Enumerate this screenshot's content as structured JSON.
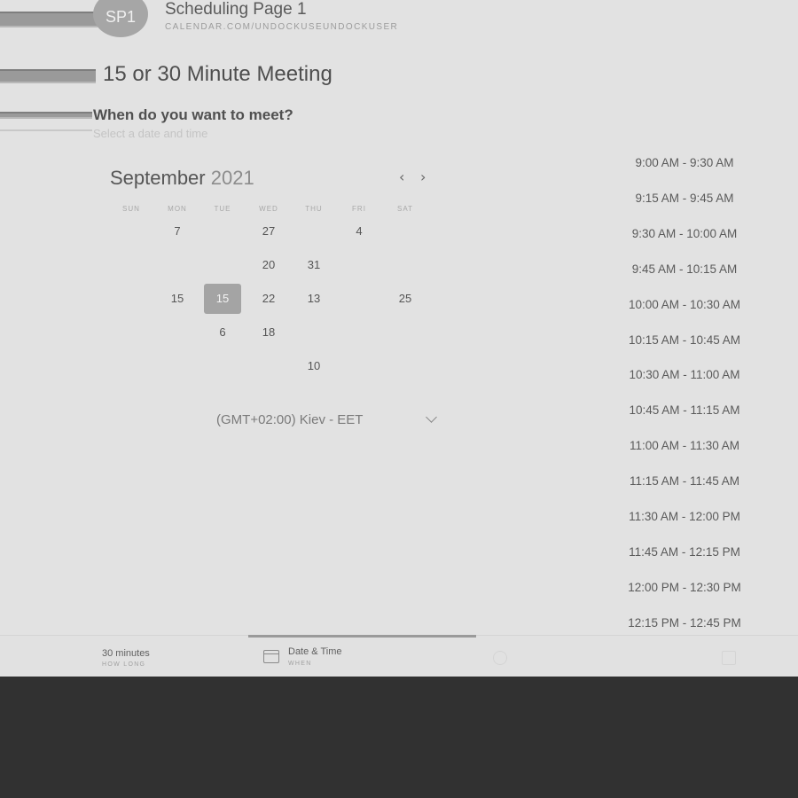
{
  "header": {
    "avatar_initials": "SP1",
    "page_name": "Scheduling Page 1",
    "page_url": "CALENDAR.COM/UNDOCKUSEUNDOCKUSER"
  },
  "event": {
    "title": "15 or 30 Minute Meeting",
    "question": "When do you want to meet?",
    "subtitle": "Select a date and time"
  },
  "calendar": {
    "month": "September",
    "year": "2021",
    "prev_icon": "chevron-left-icon",
    "next_icon": "chevron-right-icon",
    "weekdays": [
      "SUN",
      "MON",
      "TUE",
      "WED",
      "THU",
      "FRI",
      "SAT"
    ],
    "rows": [
      [
        "",
        "7",
        "",
        "27",
        "",
        "4",
        ""
      ],
      [
        "",
        "",
        "",
        "20",
        "31",
        "",
        ""
      ],
      [
        "",
        "15",
        "15",
        "22",
        "13",
        "",
        "25"
      ],
      [
        "",
        "",
        "6",
        "18",
        "",
        "",
        ""
      ],
      [
        "",
        "",
        "",
        "",
        "10",
        "",
        ""
      ]
    ],
    "selected_day": "15"
  },
  "timezone": {
    "label": "(GMT+02:00) Kiev - EET",
    "icon": "chevron-down-icon"
  },
  "time_slots": [
    "9:00 AM - 9:30 AM",
    "9:15 AM - 9:45 AM",
    "9:30 AM - 10:00 AM",
    "9:45 AM - 10:15 AM",
    "10:00 AM - 10:30 AM",
    "10:15 AM - 10:45 AM",
    "10:30 AM - 11:00 AM",
    "10:45 AM - 11:15 AM",
    "11:00 AM - 11:30 AM",
    "11:15 AM - 11:45 AM",
    "11:30 AM - 12:00 PM",
    "11:45 AM - 12:15 PM",
    "12:00 PM - 12:30 PM",
    "12:15 PM - 12:45 PM"
  ],
  "footer": {
    "duration_label": "30 minutes",
    "duration_sub": "HOW LONG",
    "datetime_label": "Date & Time",
    "datetime_sub": "WHEN",
    "datetime_icon": "calendar-icon"
  },
  "colors": {
    "selected_day_bg": "#a4a4a4",
    "page_bg": "#e2e2e2",
    "dark_area": "#313131"
  }
}
